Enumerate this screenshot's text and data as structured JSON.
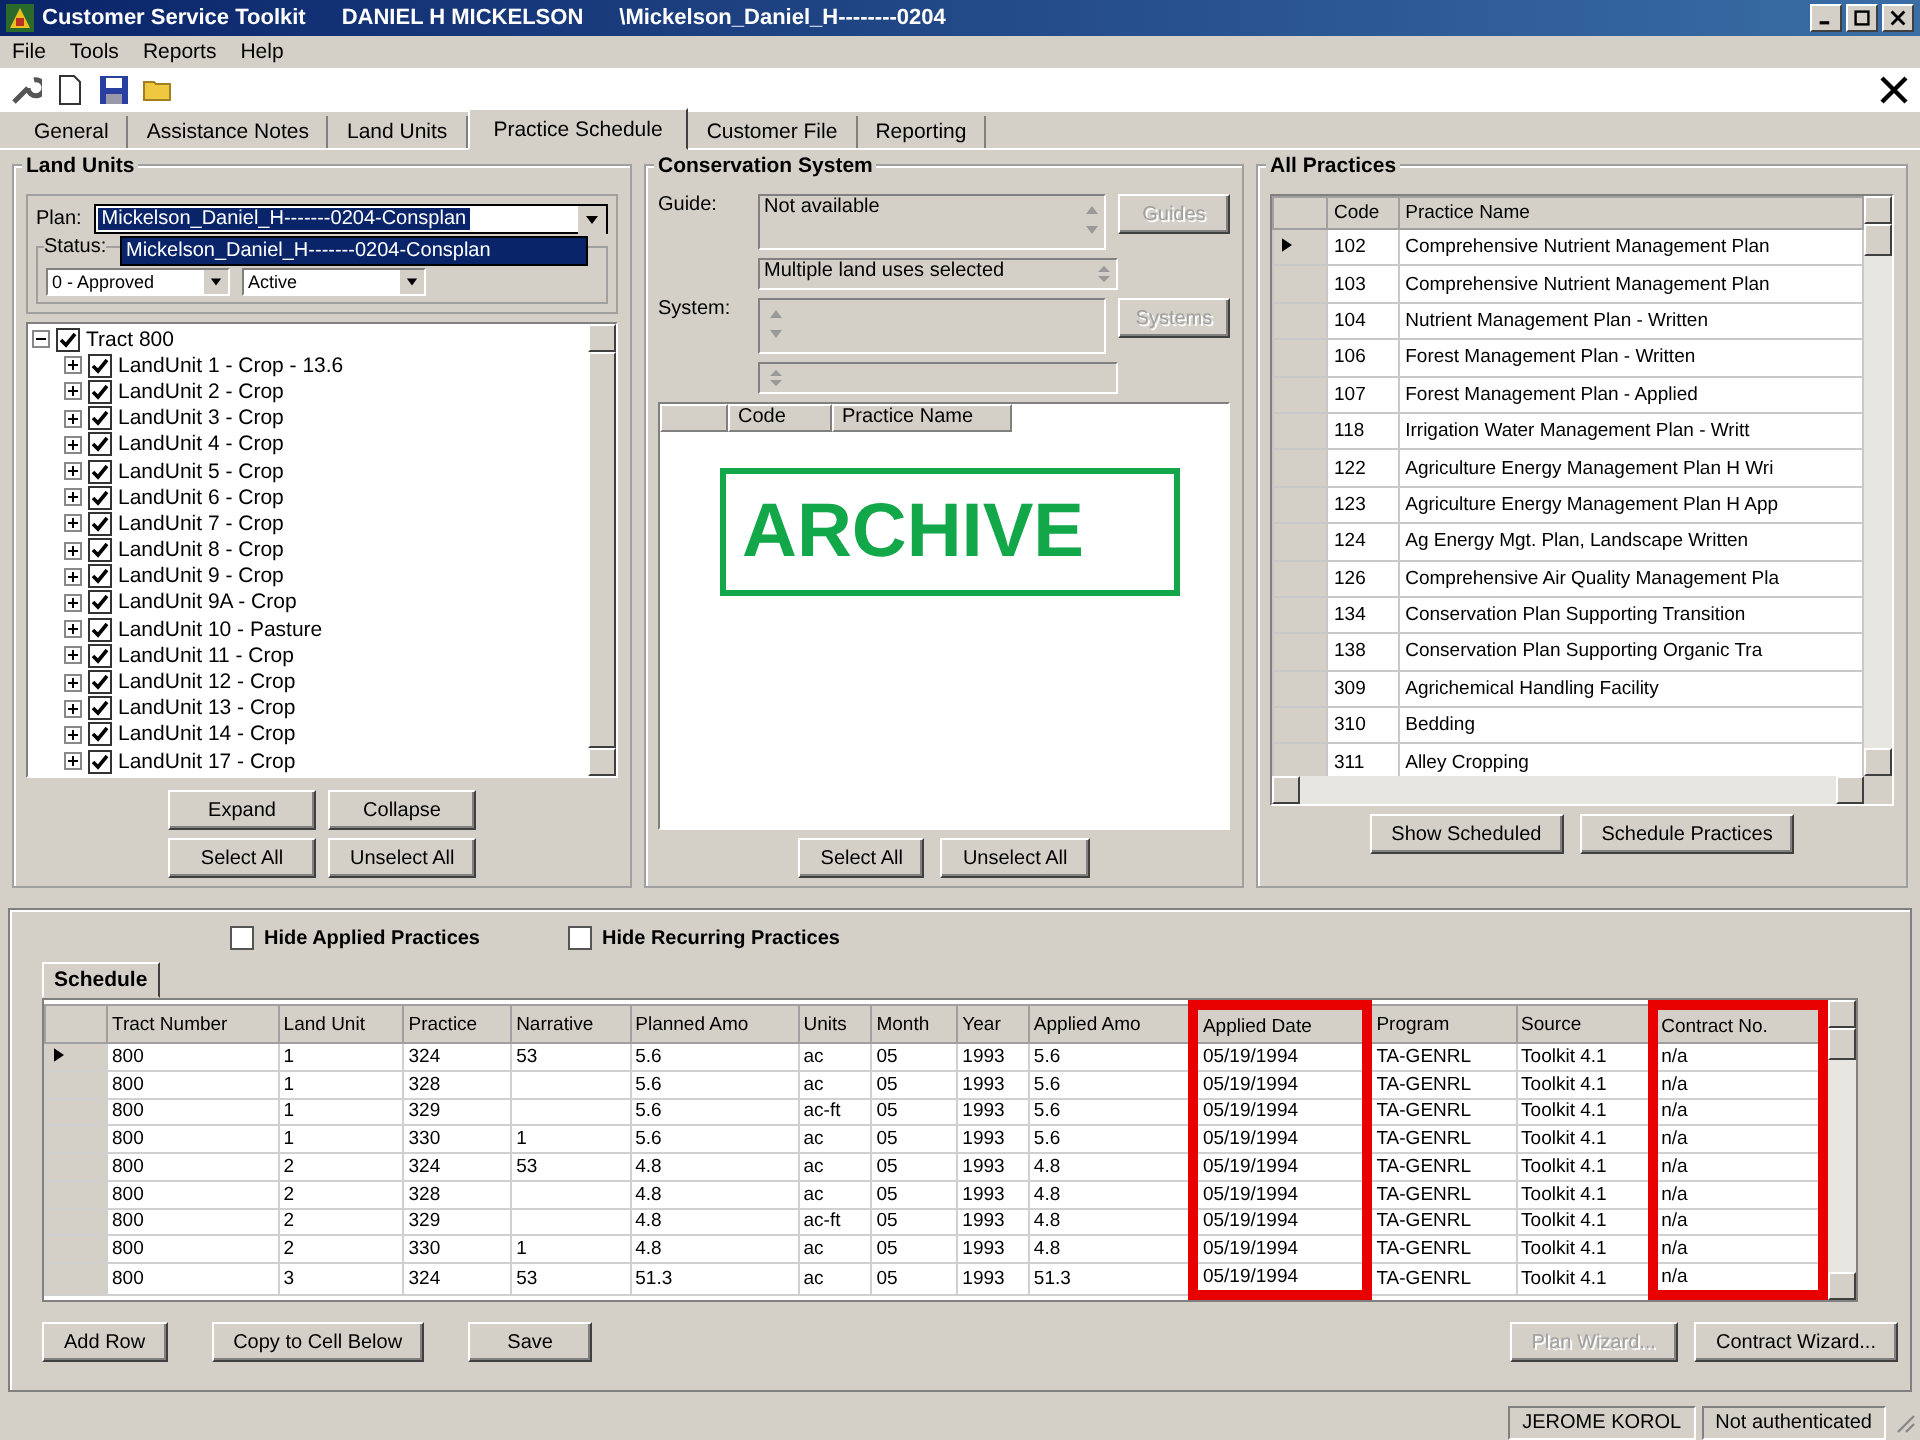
{
  "window": {
    "title": "Customer Service Toolkit",
    "user": "DANIEL H MICKELSON",
    "path": "\\Mickelson_Daniel_H--------0204"
  },
  "menu": [
    "File",
    "Tools",
    "Reports",
    "Help"
  ],
  "tabs": [
    {
      "label": "General",
      "selected": false
    },
    {
      "label": "Assistance Notes",
      "selected": false
    },
    {
      "label": "Land Units",
      "selected": false
    },
    {
      "label": "Practice Schedule",
      "selected": true
    },
    {
      "label": "Customer File",
      "selected": false
    },
    {
      "label": "Reporting",
      "selected": false
    }
  ],
  "land_units": {
    "title": "Land Units",
    "plan": {
      "label": "Plan:",
      "value": "Mickelson_Daniel_H-------0204-Consplan",
      "expanded": true,
      "options": [
        {
          "label": "Mickelson_Daniel_H-------0204-Consplan",
          "selected": true
        }
      ]
    },
    "status": {
      "label": "Status:",
      "values": [
        "0 - Approved",
        "Active"
      ]
    },
    "tree": {
      "label": "Tract 800",
      "checked": true,
      "expanded": true,
      "children": [
        {
          "label": "LandUnit 1 - Crop - 13.6",
          "checked": true,
          "expanded": false
        },
        {
          "label": "LandUnit 2 - Crop",
          "checked": true,
          "expanded": false
        },
        {
          "label": "LandUnit 3 - Crop",
          "checked": true,
          "expanded": false
        },
        {
          "label": "LandUnit 4 - Crop",
          "checked": true,
          "expanded": false
        },
        {
          "label": "LandUnit 5 - Crop",
          "checked": true,
          "expanded": false
        },
        {
          "label": "LandUnit 6 - Crop",
          "checked": true,
          "expanded": false
        },
        {
          "label": "LandUnit 7 - Crop",
          "checked": true,
          "expanded": false
        },
        {
          "label": "LandUnit 8 - Crop",
          "checked": true,
          "expanded": false
        },
        {
          "label": "LandUnit 9 - Crop",
          "checked": true,
          "expanded": false
        },
        {
          "label": "LandUnit 9A - Crop",
          "checked": true,
          "expanded": false
        },
        {
          "label": "LandUnit 10 - Pasture",
          "checked": true,
          "expanded": false
        },
        {
          "label": "LandUnit 11 - Crop",
          "checked": true,
          "expanded": false
        },
        {
          "label": "LandUnit 12 - Crop",
          "checked": true,
          "expanded": false
        },
        {
          "label": "LandUnit 13 - Crop",
          "checked": true,
          "expanded": false
        },
        {
          "label": "LandUnit 14 - Crop",
          "checked": true,
          "expanded": false
        },
        {
          "label": "LandUnit 17 - Crop",
          "checked": true,
          "expanded": false
        }
      ]
    },
    "buttons": [
      {
        "label": "Expand",
        "disabled": false
      },
      {
        "label": "Collapse",
        "disabled": false
      },
      {
        "label": "Select All",
        "disabled": false
      },
      {
        "label": "Unselect All",
        "disabled": false
      }
    ]
  },
  "conservation_system": {
    "title": "Conservation System",
    "guide": {
      "label": "Guide:",
      "value": "Not available",
      "value_2": "Multiple land uses selected",
      "button": {
        "label": "Guides",
        "disabled": true
      }
    },
    "system": {
      "label": "System:",
      "button": {
        "label": "Systems",
        "disabled": true
      }
    },
    "columns": [
      "Code",
      "Practice Name"
    ],
    "stamp": "ARCHIVE",
    "buttons": [
      {
        "label": "Select All",
        "disabled": false
      },
      {
        "label": "Unselect All",
        "disabled": false
      }
    ]
  },
  "all_practices": {
    "title": "All Practices",
    "columns": [
      "Code",
      "Practice Name"
    ],
    "rows": [
      {
        "code": "102",
        "name": "Comprehensive Nutrient Management Plan",
        "selected": true
      },
      {
        "code": "103",
        "name": "Comprehensive Nutrient Management Plan",
        "selected": false
      },
      {
        "code": "104",
        "name": "Nutrient Management Plan - Written",
        "selected": false
      },
      {
        "code": "106",
        "name": "Forest Management Plan - Written",
        "selected": false
      },
      {
        "code": "107",
        "name": "Forest Management Plan - Applied",
        "selected": false
      },
      {
        "code": "118",
        "name": "Irrigation Water Management Plan - Writt",
        "selected": false
      },
      {
        "code": "122",
        "name": "Agriculture Energy Management Plan H Wri",
        "selected": false
      },
      {
        "code": "123",
        "name": "Agriculture Energy Management Plan H App",
        "selected": false
      },
      {
        "code": "124",
        "name": "Ag Energy Mgt. Plan, Landscape Written",
        "selected": false
      },
      {
        "code": "126",
        "name": "Comprehensive Air Quality Management Pla",
        "selected": false
      },
      {
        "code": "134",
        "name": "Conservation Plan Supporting Transition",
        "selected": false
      },
      {
        "code": "138",
        "name": "Conservation Plan Supporting Organic Tra",
        "selected": false
      },
      {
        "code": "309",
        "name": "Agrichemical Handling Facility",
        "selected": false
      },
      {
        "code": "310",
        "name": "Bedding",
        "selected": false
      },
      {
        "code": "311",
        "name": "Alley Cropping",
        "selected": false
      }
    ],
    "buttons": [
      {
        "label": "Show Scheduled",
        "disabled": false
      },
      {
        "label": "Schedule Practices",
        "disabled": false
      }
    ]
  },
  "schedule": {
    "filters": [
      {
        "label": "Hide Applied Practices",
        "checked": false
      },
      {
        "label": "Hide Recurring Practices",
        "checked": false
      }
    ],
    "tab": "Schedule",
    "columns": [
      {
        "label": "Tract Number",
        "highlighted": false
      },
      {
        "label": "Land Unit",
        "highlighted": false
      },
      {
        "label": "Practice",
        "highlighted": false
      },
      {
        "label": "Narrative",
        "highlighted": false
      },
      {
        "label": "Planned Amo",
        "highlighted": false
      },
      {
        "label": "Units",
        "highlighted": false
      },
      {
        "label": "Month",
        "highlighted": false
      },
      {
        "label": "Year",
        "highlighted": false
      },
      {
        "label": "Applied Amo",
        "highlighted": false
      },
      {
        "label": "Applied Date",
        "highlighted": true
      },
      {
        "label": "Program",
        "highlighted": false
      },
      {
        "label": "Source",
        "highlighted": false
      },
      {
        "label": "Contract No.",
        "highlighted": true
      }
    ],
    "rows": [
      {
        "selected": true,
        "cells": [
          "800",
          "1",
          "324",
          "53",
          "5.6",
          "ac",
          "05",
          "1993",
          "5.6",
          "05/19/1994",
          "TA-GENRL",
          "Toolkit 4.1",
          "n/a"
        ]
      },
      {
        "selected": false,
        "cells": [
          "800",
          "1",
          "328",
          "",
          "5.6",
          "ac",
          "05",
          "1993",
          "5.6",
          "05/19/1994",
          "TA-GENRL",
          "Toolkit 4.1",
          "n/a"
        ]
      },
      {
        "selected": false,
        "cells": [
          "800",
          "1",
          "329",
          "",
          "5.6",
          "ac-ft",
          "05",
          "1993",
          "5.6",
          "05/19/1994",
          "TA-GENRL",
          "Toolkit 4.1",
          "n/a"
        ]
      },
      {
        "selected": false,
        "cells": [
          "800",
          "1",
          "330",
          "1",
          "5.6",
          "ac",
          "05",
          "1993",
          "5.6",
          "05/19/1994",
          "TA-GENRL",
          "Toolkit 4.1",
          "n/a"
        ]
      },
      {
        "selected": false,
        "cells": [
          "800",
          "2",
          "324",
          "53",
          "4.8",
          "ac",
          "05",
          "1993",
          "4.8",
          "05/19/1994",
          "TA-GENRL",
          "Toolkit 4.1",
          "n/a"
        ]
      },
      {
        "selected": false,
        "cells": [
          "800",
          "2",
          "328",
          "",
          "4.8",
          "ac",
          "05",
          "1993",
          "4.8",
          "05/19/1994",
          "TA-GENRL",
          "Toolkit 4.1",
          "n/a"
        ]
      },
      {
        "selected": false,
        "cells": [
          "800",
          "2",
          "329",
          "",
          "4.8",
          "ac-ft",
          "05",
          "1993",
          "4.8",
          "05/19/1994",
          "TA-GENRL",
          "Toolkit 4.1",
          "n/a"
        ]
      },
      {
        "selected": false,
        "cells": [
          "800",
          "2",
          "330",
          "1",
          "4.8",
          "ac",
          "05",
          "1993",
          "4.8",
          "05/19/1994",
          "TA-GENRL",
          "Toolkit 4.1",
          "n/a"
        ]
      },
      {
        "selected": false,
        "cells": [
          "800",
          "3",
          "324",
          "53",
          "51.3",
          "ac",
          "05",
          "1993",
          "51.3",
          "05/19/1994",
          "TA-GENRL",
          "Toolkit 4.1",
          "n/a"
        ]
      }
    ],
    "buttons": [
      {
        "label": "Add Row",
        "disabled": false
      },
      {
        "label": "Copy to Cell Below",
        "disabled": false
      },
      {
        "label": "Save",
        "disabled": false
      }
    ],
    "wizard_buttons": [
      {
        "label": "Plan Wizard...",
        "disabled": true
      },
      {
        "label": "Contract Wizard...",
        "disabled": false
      }
    ]
  },
  "status_bar": [
    "JEROME KOROL",
    "Not authenticated"
  ]
}
